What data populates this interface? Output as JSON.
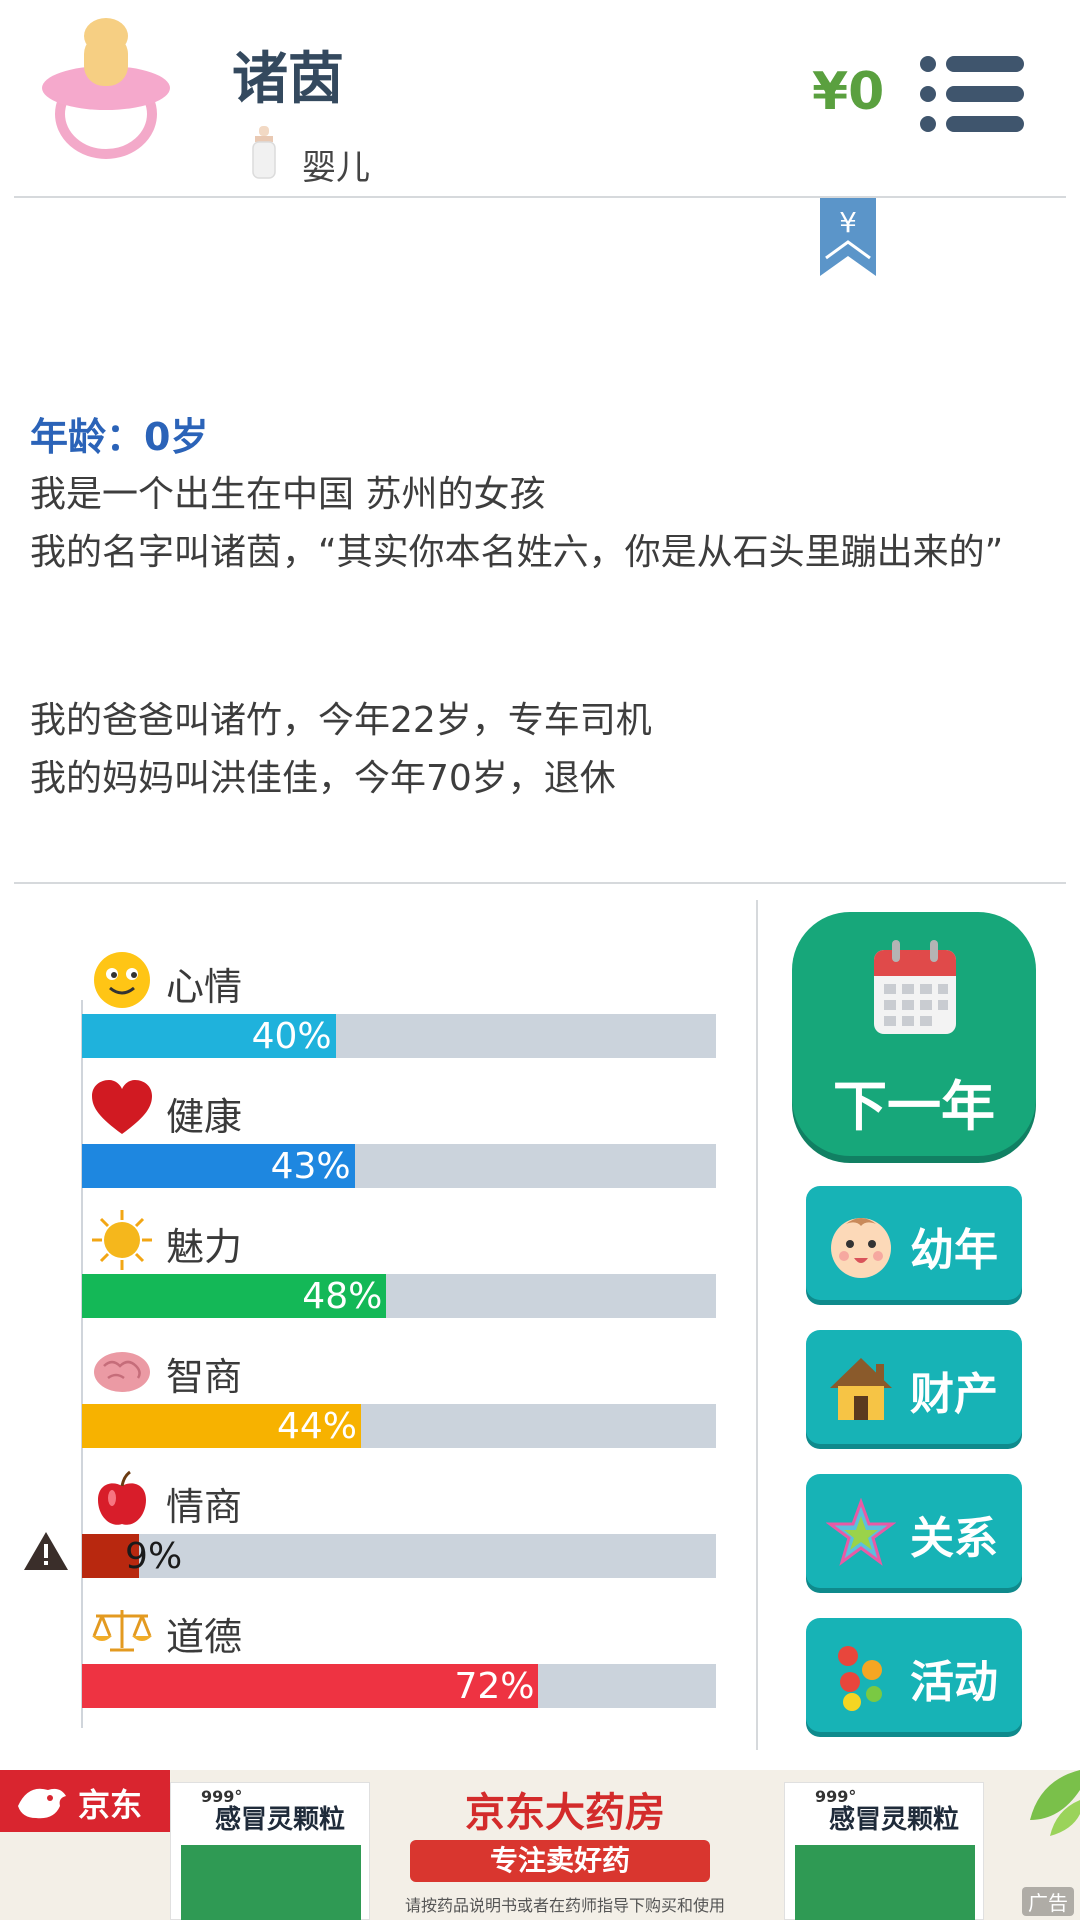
{
  "header": {
    "name": "诸茵",
    "stage": "婴儿",
    "money": "¥0"
  },
  "bookmark": {
    "symbol": "¥"
  },
  "story": {
    "age": "年龄：0岁",
    "line1": "我是一个出生在中国 苏州的女孩",
    "line2": "我的名字叫诸茵，“其实你本名姓六，你是从石头里蹦出来的”",
    "line3": "我的爸爸叫诸竹，今年22岁，专车司机",
    "line4": "我的妈妈叫洪佳佳，今年70岁，退休"
  },
  "stats": [
    {
      "label": "心情",
      "value": 40,
      "text": "40%",
      "color": "#1fb2dc",
      "icon": "smiley-icon"
    },
    {
      "label": "健康",
      "value": 43,
      "text": "43%",
      "color": "#1e87e0",
      "icon": "heart-icon"
    },
    {
      "label": "魅力",
      "value": 48,
      "text": "48%",
      "color": "#14b857",
      "icon": "sun-icon"
    },
    {
      "label": "智商",
      "value": 44,
      "text": "44%",
      "color": "#f7b200",
      "icon": "brain-icon"
    },
    {
      "label": "情商",
      "value": 9,
      "text": "9%",
      "color": "#b8280f",
      "icon": "apple-icon"
    },
    {
      "label": "道德",
      "value": 72,
      "text": "72%",
      "color": "#ee3342",
      "icon": "scales-icon"
    }
  ],
  "buttons": {
    "next_year": "下一年",
    "childhood": "幼年",
    "property": "财产",
    "relations": "关系",
    "activities": "活动"
  },
  "ad": {
    "brand": "京东",
    "title": "京东大药房",
    "slogan": "专注卖好药",
    "note": "请按药品说明书或者在药师指导下购买和使用",
    "product_brand": "999°",
    "product_name": "感冒灵颗粒",
    "tag": "广告"
  }
}
